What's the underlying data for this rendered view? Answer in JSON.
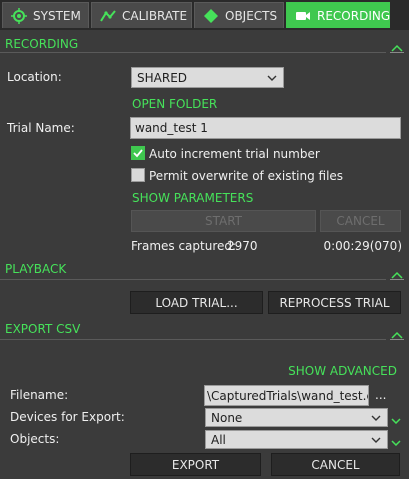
{
  "tabs": [
    {
      "label": "SYSTEM",
      "icon": "chip-icon",
      "active": false
    },
    {
      "label": "CALIBRATE",
      "icon": "calibrate-icon",
      "active": false
    },
    {
      "label": "OBJECTS",
      "icon": "diamond-icon",
      "active": false
    },
    {
      "label": "RECORDING",
      "icon": "video-camera-icon",
      "active": true
    }
  ],
  "recording": {
    "section_title": "RECORDING",
    "location_label": "Location:",
    "location_value": "SHARED",
    "open_folder": "OPEN FOLDER",
    "trial_name_label": "Trial Name:",
    "trial_name_value": "wand_test 1",
    "auto_increment_label": "Auto increment trial number",
    "auto_increment_checked": true,
    "permit_overwrite_label": "Permit overwrite of existing files",
    "permit_overwrite_checked": false,
    "show_parameters": "SHOW PARAMETERS",
    "start_label": "START",
    "cancel_label": "CANCEL",
    "frames_captured_label": "Frames captured:",
    "frames_captured_value": "2970",
    "elapsed": "0:00:29(070)"
  },
  "playback": {
    "section_title": "PLAYBACK",
    "load_trial_label": "LOAD TRIAL...",
    "reprocess_trial_label": "REPROCESS TRIAL"
  },
  "export_csv": {
    "section_title": "EXPORT CSV",
    "show_advanced": "SHOW ADVANCED",
    "filename_label": "Filename:",
    "filename_value": "\\CapturedTrials\\wand_test.csv",
    "browse_label": "...",
    "devices_label": "Devices for Export:",
    "devices_value": "None",
    "objects_label": "Objects:",
    "objects_value": "All",
    "export_label": "EXPORT",
    "cancel_label": "CANCEL"
  },
  "colors": {
    "accent": "#46e25a",
    "active_tab": "#3fc84f",
    "background": "#3b3b3b"
  }
}
